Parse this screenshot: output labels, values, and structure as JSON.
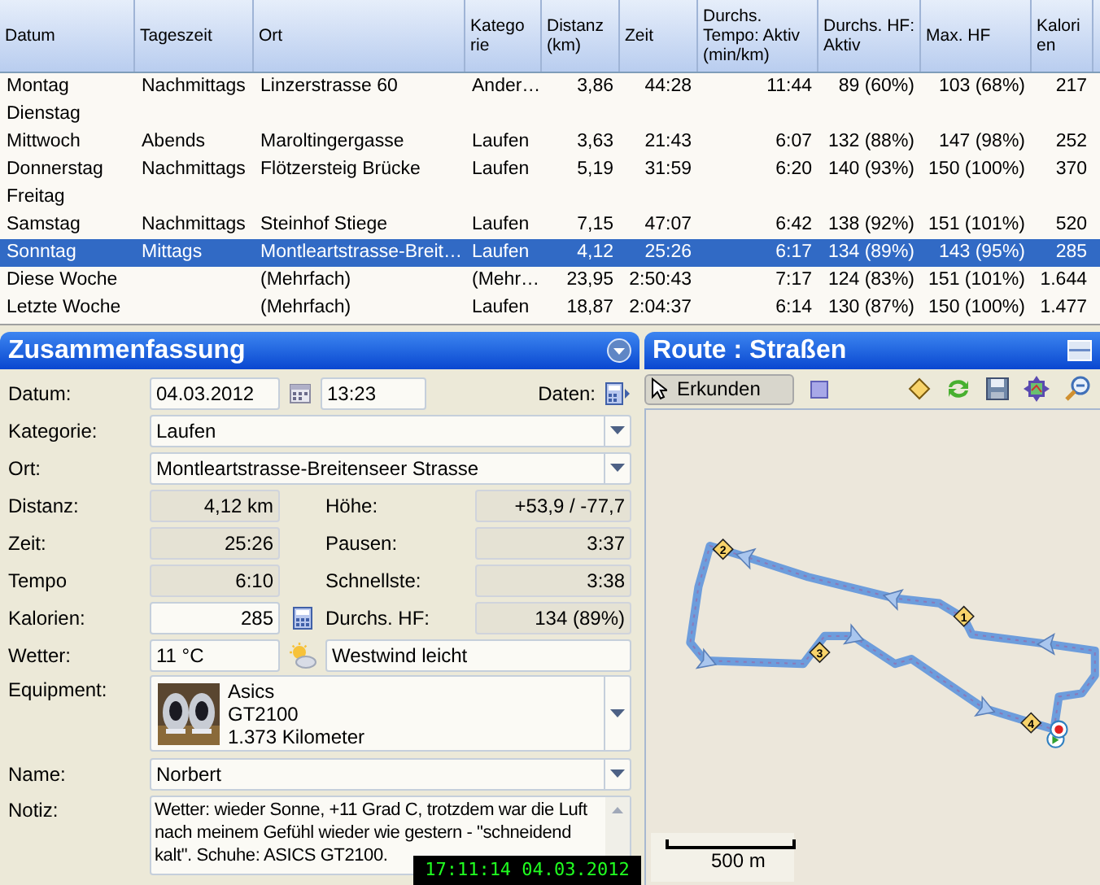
{
  "table": {
    "columns": [
      "Datum",
      "Tageszeit",
      "Ort",
      "Katego rie",
      "Distanz (km)",
      "Zeit",
      "Durchs. Tempo: Aktiv (min/km)",
      "Durchs. HF: Aktiv",
      "Max. HF",
      "Kalori en"
    ],
    "rows": [
      {
        "selected": false,
        "cells": [
          "Montag",
          "Nachmittags",
          "Linzerstrasse 60",
          "Ander…",
          "3,86",
          "44:28",
          "11:44",
          "89 (60%)",
          "103 (68%)",
          "217"
        ]
      },
      {
        "selected": false,
        "cells": [
          "Dienstag"
        ]
      },
      {
        "selected": false,
        "cells": [
          "Mittwoch",
          "Abends",
          "Maroltingergasse",
          "Laufen",
          "3,63",
          "21:43",
          "6:07",
          "132 (88%)",
          "147 (98%)",
          "252"
        ]
      },
      {
        "selected": false,
        "cells": [
          "Donnerstag",
          "Nachmittags",
          "Flötzersteig Brücke",
          "Laufen",
          "5,19",
          "31:59",
          "6:20",
          "140 (93%)",
          "150 (100%)",
          "370"
        ]
      },
      {
        "selected": false,
        "cells": [
          "Freitag"
        ]
      },
      {
        "selected": false,
        "cells": [
          "Samstag",
          "Nachmittags",
          "Steinhof Stiege",
          "Laufen",
          "7,15",
          "47:07",
          "6:42",
          "138 (92%)",
          "151 (101%)",
          "520"
        ]
      },
      {
        "selected": true,
        "cells": [
          "Sonntag",
          "Mittags",
          "Montleartstrasse-Breit…",
          "Laufen",
          "4,12",
          "25:26",
          "6:17",
          "134 (89%)",
          "143 (95%)",
          "285"
        ]
      },
      {
        "selected": false,
        "cells": [
          "Diese Woche",
          "",
          "(Mehrfach)",
          "(Mehr…",
          "23,95",
          "2:50:43",
          "7:17",
          "124 (83%)",
          "151 (101%)",
          "1.644"
        ]
      },
      {
        "selected": false,
        "cells": [
          "Letzte Woche",
          "",
          "(Mehrfach)",
          "Laufen",
          "18,87",
          "2:04:37",
          "6:14",
          "130 (87%)",
          "150 (100%)",
          "1.477"
        ]
      }
    ]
  },
  "summary": {
    "title": "Zusammenfassung",
    "date_label": "Datum:",
    "date": "04.03.2012",
    "time": "13:23",
    "data_label": "Daten:",
    "category_label": "Kategorie:",
    "category": "Laufen",
    "location_label": "Ort:",
    "location": "Montleartstrasse-Breitenseer Strasse",
    "stats": [
      {
        "left": {
          "label": "Distanz:",
          "value": "4,12 km",
          "kind": "readonly"
        },
        "right": {
          "label": "Höhe:",
          "value": "+53,9 / -77,7"
        }
      },
      {
        "left": {
          "label": "Zeit:",
          "value": "25:26",
          "kind": "readonly"
        },
        "right": {
          "label": "Pausen:",
          "value": "3:37"
        }
      },
      {
        "left": {
          "label": "Tempo",
          "value": "6:10",
          "kind": "readonly"
        },
        "right": {
          "label": "Schnellste:",
          "value": "3:38"
        }
      },
      {
        "left": {
          "label": "Kalorien:",
          "value": "285",
          "kind": "input"
        },
        "right": {
          "label": "Durchs. HF:",
          "value": "134 (89%)"
        }
      }
    ],
    "weather_label": "Wetter:",
    "temperature": "11 °C",
    "wind": "Westwind leicht",
    "equipment_label": "Equipment:",
    "equipment": [
      "Asics",
      "GT2100",
      "1.373 Kilometer"
    ],
    "name_label": "Name:",
    "name": "Norbert",
    "note_label": "Notiz:",
    "note": "Wetter: wieder Sonne, +11 Grad C, trotzdem war die Luft nach meinem Gefühl wieder wie gestern - \"schneidend kalt\". Schuhe: ASICS GT2100."
  },
  "map": {
    "title": "Route : Straßen",
    "tool": "Erkunden",
    "waypoints": [
      "1",
      "2",
      "3",
      "4"
    ],
    "scale": "500 m"
  },
  "clock": "17:11:14 04.03.2012"
}
